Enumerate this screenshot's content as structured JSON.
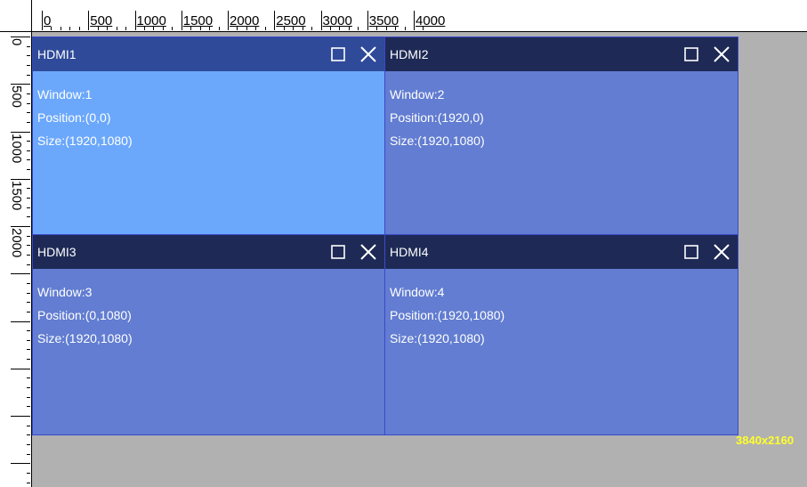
{
  "ruler": {
    "top_labels": [
      "0",
      "500",
      "1000",
      "1500",
      "2000",
      "2500",
      "3000",
      "3500",
      "4000"
    ],
    "left_labels": [
      "0",
      "500",
      "1000",
      "1500",
      "2000"
    ]
  },
  "windows": [
    {
      "title": "HDMI1",
      "window": "Window:1",
      "position": "Position:(0,0)",
      "size": "Size:(1920,1080)"
    },
    {
      "title": "HDMI2",
      "window": "Window:2",
      "position": "Position:(1920,0)",
      "size": "Size:(1920,1080)"
    },
    {
      "title": "HDMI3",
      "window": "Window:3",
      "position": "Position:(0,1080)",
      "size": "Size:(1920,1080)"
    },
    {
      "title": "HDMI4",
      "window": "Window:4",
      "position": "Position:(1920,1080)",
      "size": "Size:(1920,1080)"
    }
  ],
  "canvas_resolution": "3840x2160",
  "icons": {
    "maximize": "maximize-icon",
    "close": "close-icon"
  },
  "colors": {
    "active_window": "#6ba8fb",
    "inactive_window": "#627dd1",
    "titlebar": "#1e2a55",
    "active_titlebar": "#2f4a99",
    "resolution_label": "#ffff2b",
    "background": "#b1b1b1"
  }
}
